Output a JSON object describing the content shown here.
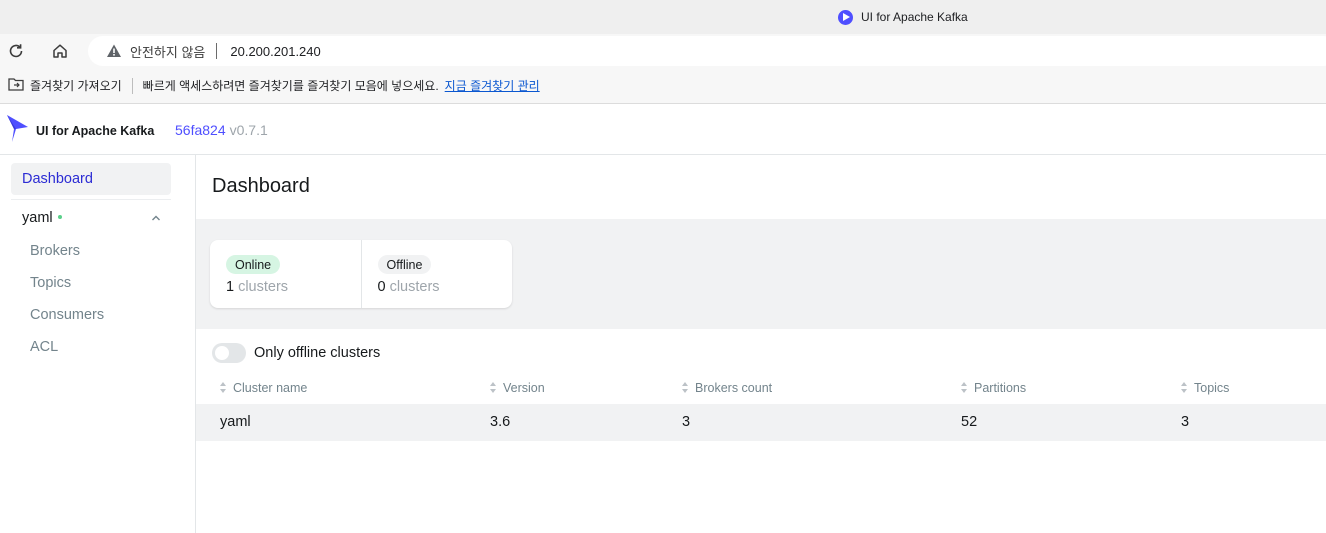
{
  "browser": {
    "tab": {
      "title": "UI for Apache Kafka",
      "icon": "kafka-ui-favicon"
    },
    "address": {
      "security_label": "안전하지 않음",
      "url": "20.200.201.240"
    },
    "bookmarks": {
      "import_label": "즐겨찾기 가져오기",
      "hint": "빠르게 액세스하려면 즐겨찾기를 즐겨찾기 모음에 넣으세요.",
      "manage_link": "지금 즐겨찾기 관리"
    }
  },
  "header": {
    "app_name": "UI for Apache Kafka",
    "commit": "56fa824",
    "version": "v0.7.1"
  },
  "sidebar": {
    "dashboard": "Dashboard",
    "cluster": {
      "name": "yaml",
      "status_color": "#5ad08a"
    },
    "items": [
      {
        "label": "Brokers"
      },
      {
        "label": "Topics"
      },
      {
        "label": "Consumers"
      },
      {
        "label": "ACL"
      }
    ]
  },
  "main": {
    "title": "Dashboard",
    "metrics": {
      "online": {
        "label": "Online",
        "count": "1",
        "unit": "clusters"
      },
      "offline": {
        "label": "Offline",
        "count": "0",
        "unit": "clusters"
      }
    },
    "toggle": {
      "label": "Only offline clusters",
      "checked": false
    },
    "table": {
      "columns": [
        "Cluster name",
        "Version",
        "Brokers count",
        "Partitions",
        "Topics"
      ],
      "rows": [
        {
          "name": "yaml",
          "version": "3.6",
          "brokers": "3",
          "partitions": "52",
          "topics": "3"
        }
      ]
    }
  },
  "colors": {
    "accent": "#4f4fff",
    "online_badge": "#d6f5e3",
    "active_nav_text": "#2c2cd4"
  }
}
